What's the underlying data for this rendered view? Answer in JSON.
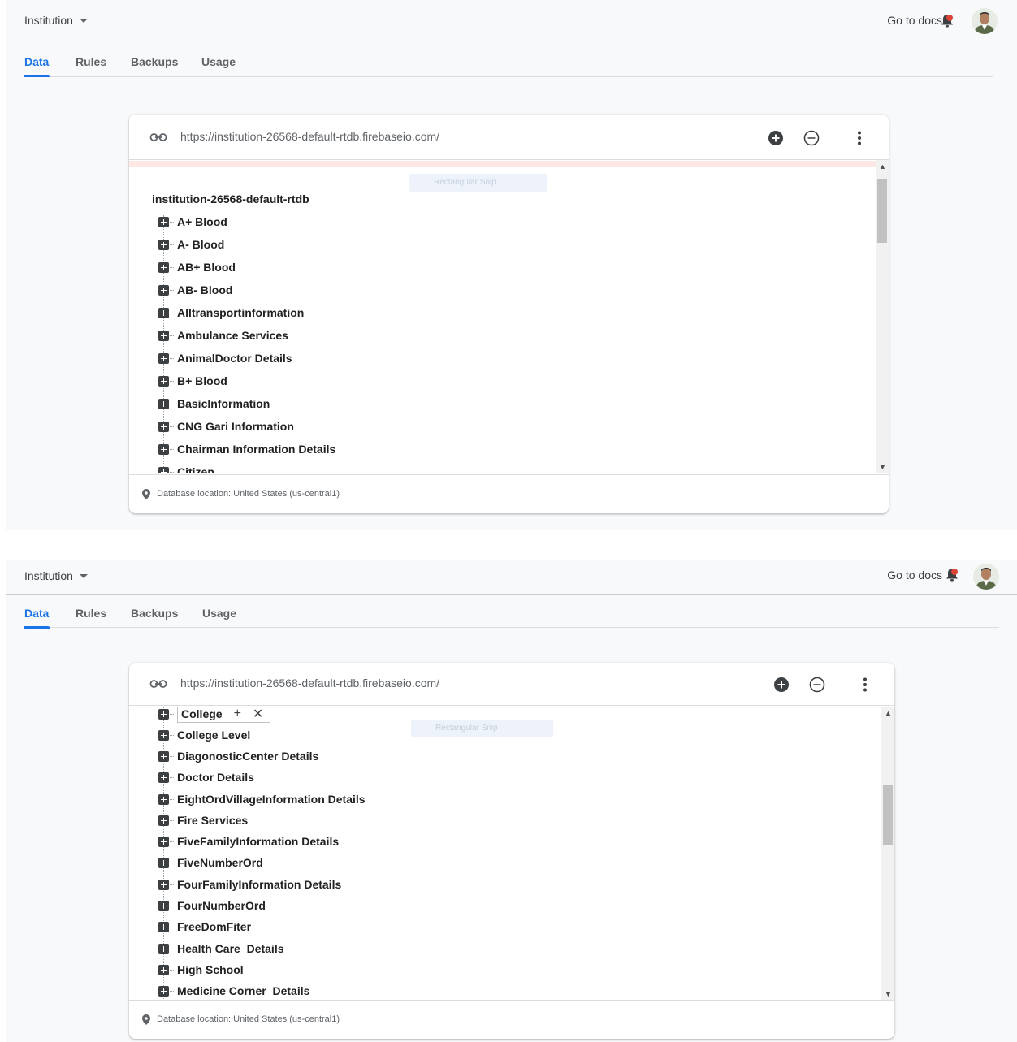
{
  "colors": {
    "accent": "#1a73e8",
    "bell": "#db4437",
    "error_strip": "#fde8e6",
    "expand_box": "#3c4043"
  },
  "screen1": {
    "project": "Institution",
    "go_to_docs": "Go to docs",
    "tabs": [
      "Data",
      "Rules",
      "Backups",
      "Usage"
    ],
    "active_tab": "Data",
    "url": "https://institution-26568-default-rtdb.firebaseio.com/",
    "ghost_tooltip": "Rectangular Snip",
    "root": "institution-26568-default-rtdb",
    "nodes": [
      "A+ Blood",
      "A- Blood",
      "AB+ Blood",
      "AB- Blood",
      "Alltransportinformation",
      "Ambulance Services",
      "AnimalDoctor Details",
      "B+ Blood",
      "BasicInformation",
      "CNG Gari Information",
      "Chairman Information Details",
      "Citizen"
    ],
    "location": "Database location: United States (us-central1)"
  },
  "screen2": {
    "project": "Institution",
    "go_to_docs": "Go to docs",
    "tabs": [
      "Data",
      "Rules",
      "Backups",
      "Usage"
    ],
    "active_tab": "Data",
    "url": "https://institution-26568-default-rtdb.firebaseio.com/",
    "ghost_tooltip": "Rectangular Snip",
    "editing_node": "College",
    "nodes": [
      "College Level",
      "DiagonosticCenter Details",
      "Doctor Details",
      "EightOrdVillageInformation Details",
      "Fire Services",
      "FiveFamilyInformation Details",
      "FiveNumberOrd",
      "FourFamilyInformation Details",
      "FourNumberOrd",
      "FreeDomFiter",
      "Health Care  Details",
      "High School",
      "Medicine Corner  Details"
    ],
    "location": "Database location: United States (us-central1)"
  }
}
